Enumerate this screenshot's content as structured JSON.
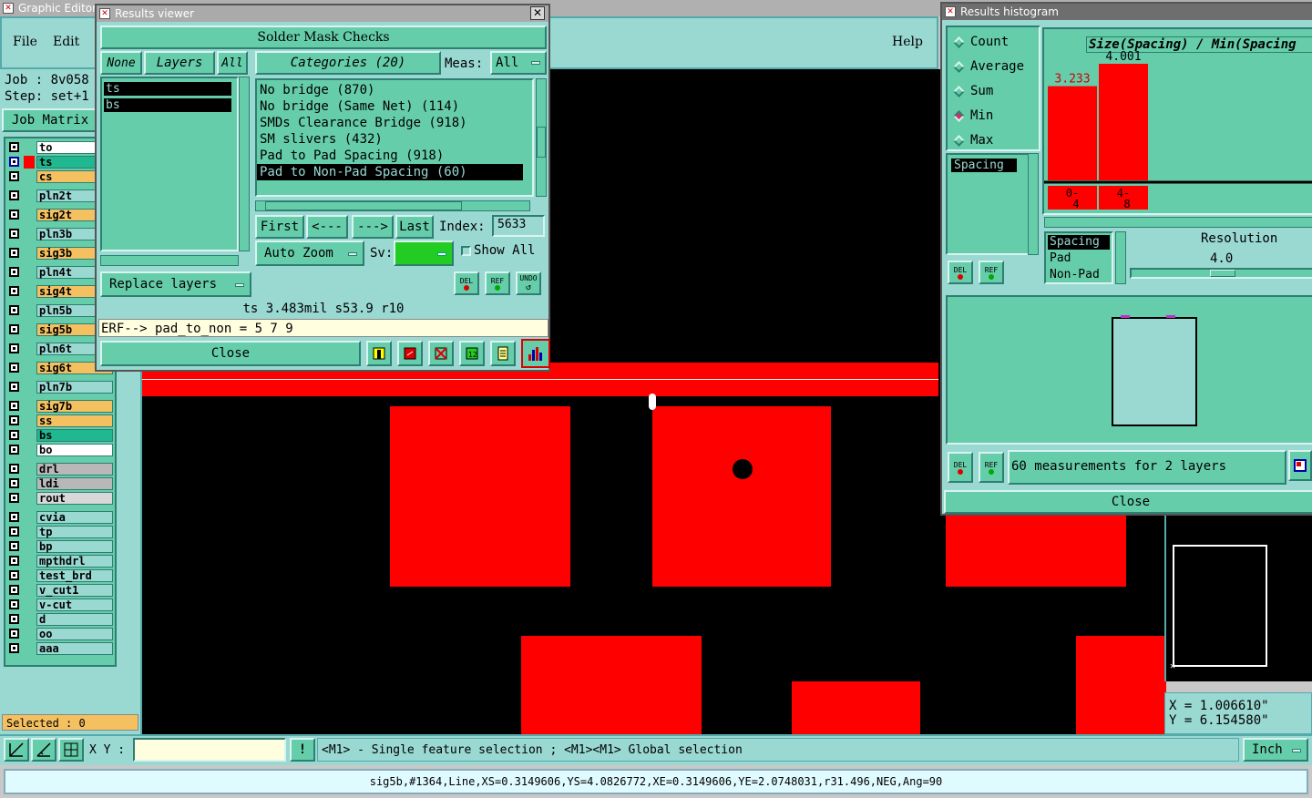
{
  "main_window": {
    "title": "Graphic Editor",
    "menu": {
      "file": "File",
      "edit": "Edit",
      "help": "Help"
    },
    "job_label": "Job : 8v058",
    "step_label": "Step: set+1",
    "job_matrix": "Job Matrix",
    "layers": [
      "to",
      "ts",
      "cs",
      "pln2t",
      "sig2t",
      "pln3b",
      "sig3b",
      "pln4t",
      "sig4t",
      "pln5b",
      "sig5b",
      "pln6t",
      "sig6t",
      "pln7b",
      "sig7b",
      "ss",
      "bs",
      "bo",
      "drl",
      "ldi",
      "rout",
      "cvia",
      "tp",
      "bp",
      "mpthdrl",
      "test_brd",
      "v_cut1",
      "v-cut",
      "d",
      "oo",
      "aaa"
    ],
    "selected": "Selected : 0",
    "xy_label": "X Y :",
    "xy_value": "",
    "hint": "<M1> - Single feature selection ; <M1><M1> Global selection",
    "units": "Inch",
    "status": "sig5b,#1364,Line,XS=0.3149606,YS=4.0826772,XE=0.3149606,YE=2.0748031,r31.496,NEG,Ang=90",
    "coord_x": "X = 1.006610\"",
    "coord_y": "Y = 6.154580\""
  },
  "results_viewer": {
    "title": "Results viewer",
    "header": "Solder Mask Checks",
    "none": "None",
    "layers_btn": "Layers",
    "all_btn": "All",
    "categories": "Categories (20)",
    "meas_label": "Meas:",
    "meas_value": "All",
    "layer_list": [
      "ts",
      "bs"
    ],
    "category_list": [
      "No bridge (870)",
      "No bridge (Same Net) (114)",
      "SMDs Clearance Bridge (918)",
      "SM slivers (432)",
      "Pad to Pad Spacing (918)",
      "Pad to Non-Pad Spacing (60)"
    ],
    "first": "First",
    "prev": "<---",
    "next": "--->",
    "last": "Last",
    "index_label": "Index:",
    "index_value": "5633",
    "auto_zoom": "Auto Zoom",
    "sv_label": "Sv:",
    "show_all": "Show All",
    "replace_layers": "Replace layers",
    "del": "DEL",
    "ref": "REF",
    "undo": "UNDO",
    "info": "ts 3.483mil  s53.9  r10",
    "erf": "ERF--> pad_to_non = 5 7 9",
    "close": "Close",
    "colors": {
      "sv_color": "#22cc22"
    }
  },
  "histogram": {
    "title": "Results histogram",
    "modes": [
      "Count",
      "Average",
      "Sum",
      "Min",
      "Max"
    ],
    "selected_mode": "Min",
    "list1": [
      "Spacing"
    ],
    "chart_title": "Size(Spacing) / Min(Spacing",
    "resolution_label": "Resolution",
    "resolution_value": "4.0",
    "list2": [
      "Spacing",
      "Pad",
      "Non-Pad"
    ],
    "measurements": "60 measurements for 2 layers",
    "del": "DEL",
    "ref": "REF",
    "close": "Close"
  },
  "chart_data": {
    "type": "bar",
    "categories": [
      "0-4",
      "4-8"
    ],
    "values": [
      3.233,
      4.001
    ],
    "title": "Size(Spacing) / Min(Spacing",
    "bar_color": "#ff0000"
  }
}
